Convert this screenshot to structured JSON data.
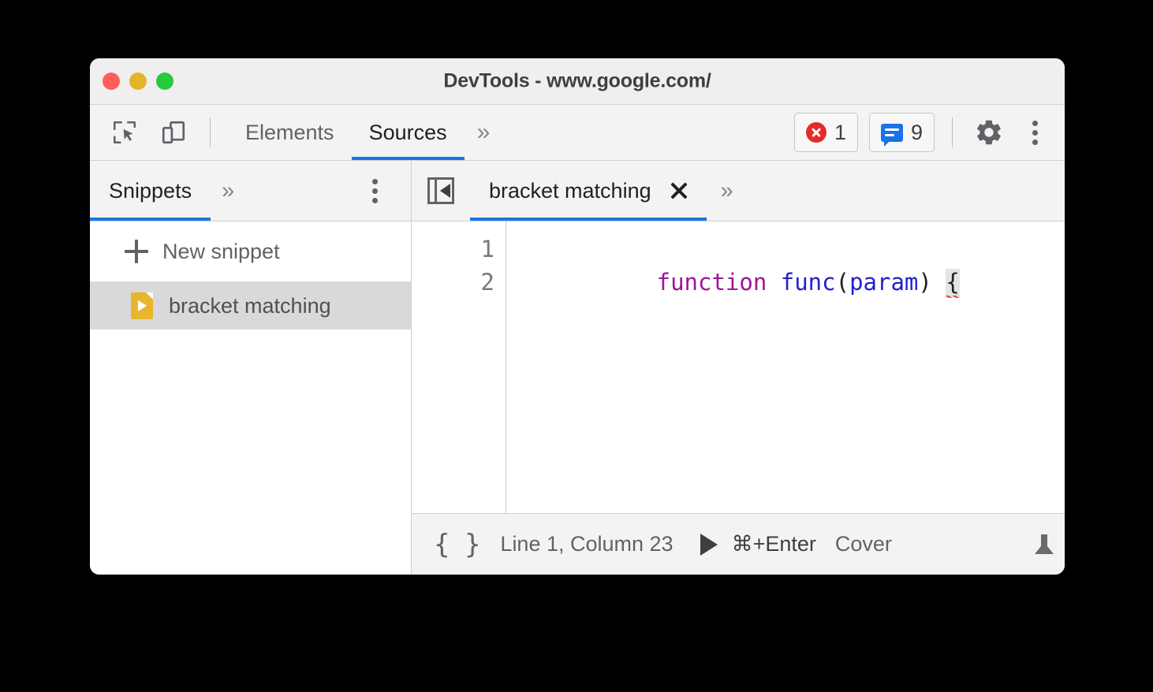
{
  "window": {
    "title": "DevTools - www.google.com/",
    "traffic_lights": [
      {
        "name": "close",
        "color": "#ff5f56"
      },
      {
        "name": "minimize",
        "color": "#e3b32a"
      },
      {
        "name": "zoom",
        "color": "#27c93f"
      }
    ]
  },
  "toolbar": {
    "inspect_icon": "inspect-element-icon",
    "device_icon": "device-toolbar-icon",
    "tabs": [
      {
        "label": "Elements",
        "active": false
      },
      {
        "label": "Sources",
        "active": true
      }
    ],
    "more_tabs_glyph": "»",
    "errors": {
      "icon": "error-circle-icon",
      "count": "1"
    },
    "messages": {
      "icon": "message-bubble-icon",
      "count": "9"
    },
    "settings_icon": "gear-icon",
    "more_icon": "kebab-menu-icon"
  },
  "sidebar": {
    "tab_label": "Snippets",
    "more_tabs_glyph": "»",
    "more_icon": "kebab-menu-icon",
    "new_snippet_label": "New snippet",
    "snippets": [
      {
        "name": "bracket matching",
        "selected": true
      }
    ]
  },
  "editor": {
    "collapse_icon": "collapse-sidebar-icon",
    "tab_label": "bracket matching",
    "close_glyph": "×",
    "more_tabs_glyph": "»",
    "line_numbers": [
      "1",
      "2"
    ],
    "code_tokens": [
      {
        "text": "function",
        "type": "keyword"
      },
      {
        "text": " ",
        "type": "plain"
      },
      {
        "text": "func",
        "type": "function"
      },
      {
        "text": "(",
        "type": "punct"
      },
      {
        "text": "param",
        "type": "param"
      },
      {
        "text": ")",
        "type": "punct"
      },
      {
        "text": " ",
        "type": "plain"
      },
      {
        "text": "{",
        "type": "brace-highlighted"
      }
    ],
    "annotation": {
      "shape": "rounded-rect-outline",
      "color": "#1a4fe0",
      "targets": "{"
    }
  },
  "statusbar": {
    "pretty_print_glyph": "{ }",
    "cursor_position": "Line 1, Column 23",
    "run_icon": "play-icon",
    "run_shortcut": "⌘+Enter",
    "coverage_label": "Coverage",
    "drawer_icon": "show-drawer-icon"
  },
  "colors": {
    "accent": "#1a73e8",
    "annotation": "#1a4fe0",
    "error": "#e42a2a",
    "keyword": "#a0149b",
    "identifier": "#2222cc",
    "snippet_icon": "#e8b62c"
  }
}
